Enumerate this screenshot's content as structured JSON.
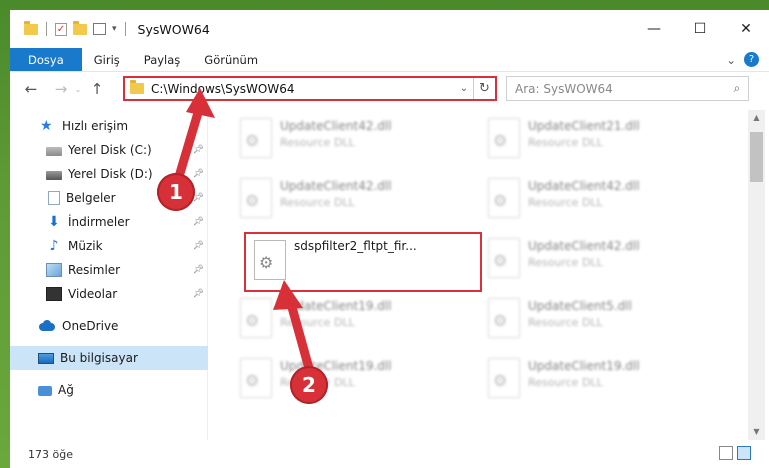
{
  "window": {
    "title": "SysWOW64",
    "controls": {
      "minimize": "—",
      "maximize": "☐",
      "close": "✕"
    }
  },
  "ribbon": {
    "tabs": [
      "Dosya",
      "Giriş",
      "Paylaş",
      "Görünüm"
    ],
    "expand_icon": "chevron-down-icon",
    "help_icon": "help-icon"
  },
  "navbar": {
    "back_icon": "back-arrow-icon",
    "forward_icon": "forward-arrow-icon",
    "up_icon": "up-arrow-icon",
    "address_path": "C:\\Windows\\SysWOW64",
    "search_placeholder": "Ara: SysWOW64"
  },
  "sidebar": {
    "items": [
      {
        "label": "Hızlı erişim",
        "icon": "star-icon",
        "pinned": false
      },
      {
        "label": "Yerel Disk (C:)",
        "icon": "drive-icon",
        "pinned": true
      },
      {
        "label": "Yerel Disk (D:)",
        "icon": "drive-icon",
        "pinned": true
      },
      {
        "label": "Belgeler",
        "icon": "documents-icon",
        "pinned": true
      },
      {
        "label": "İndirmeler",
        "icon": "download-icon",
        "pinned": true
      },
      {
        "label": "Müzik",
        "icon": "music-icon",
        "pinned": true
      },
      {
        "label": "Resimler",
        "icon": "pictures-icon",
        "pinned": true
      },
      {
        "label": "Videolar",
        "icon": "videos-icon",
        "pinned": true
      },
      {
        "label": "OneDrive",
        "icon": "onedrive-icon",
        "pinned": false
      },
      {
        "label": "Bu bilgisayar",
        "icon": "this-pc-icon",
        "pinned": false,
        "selected": true
      },
      {
        "label": "Ağ",
        "icon": "network-icon",
        "pinned": false
      }
    ]
  },
  "files": [
    {
      "name": "UpdateClient42.dll",
      "desc": "Resource DLL"
    },
    {
      "name": "UpdateClient21.dll",
      "desc": "Resource DLL"
    },
    {
      "name": "UpdateClient42.dll",
      "desc": "Resource DLL"
    },
    {
      "name": "UpdateClient42.dll",
      "desc": "Resource DLL"
    },
    {
      "name": "sdspfilter2_fltpt_fir...",
      "desc": ""
    },
    {
      "name": "UpdateClient42.dll",
      "desc": "Resource DLL"
    },
    {
      "name": "UpdateClient19.dll",
      "desc": "Resource DLL"
    },
    {
      "name": "UpdateClient5.dll",
      "desc": "Resource DLL"
    },
    {
      "name": "UpdateClient19.dll",
      "desc": "Resource DLL"
    },
    {
      "name": "UpdateClient19.dll",
      "desc": "Resource DLL"
    }
  ],
  "status": {
    "item_count": "173 öğe"
  },
  "annotations": {
    "badge1": "1",
    "badge2": "2"
  },
  "colors": {
    "accent": "#1979ca",
    "highlight_red": "#d9303c",
    "selection": "#cce4f7"
  }
}
